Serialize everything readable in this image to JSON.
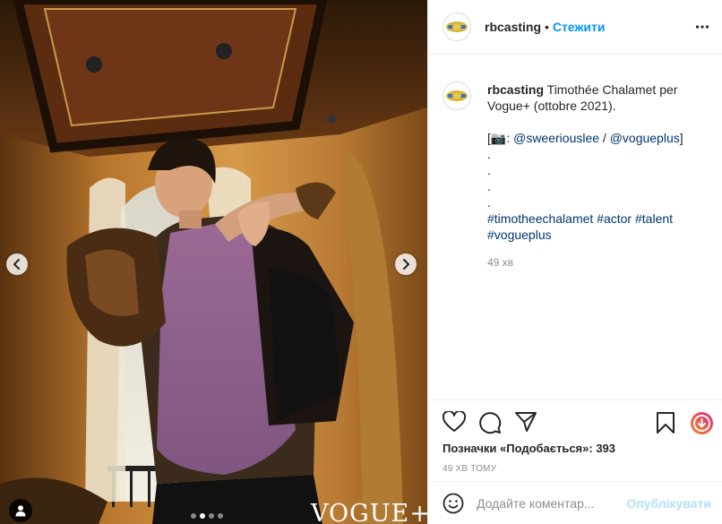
{
  "post": {
    "username": "rbcasting",
    "separator": "•",
    "follow_label": "Стежити",
    "more_icon": "more-dots-icon"
  },
  "caption": {
    "username": "rbcasting",
    "text_line1": "Timothée Chalamet per",
    "text_line2": "Vogue+ (ottobre 2021).",
    "credit_prefix": "[",
    "camera_emoji": "📷",
    "credit_colon": ": ",
    "mention1": "@sweeriouslee",
    "credit_sep": " / ",
    "mention2": "@vogueplus",
    "credit_suffix": "]",
    "dots": [
      ".",
      ".",
      ".",
      "."
    ],
    "hashtags_line1": [
      "#timotheechalamet",
      "#actor",
      "#talent"
    ],
    "hashtags_line2": [
      "#vogueplus"
    ],
    "time_ago": "49 хв"
  },
  "photo": {
    "watermark": "VOGUE+",
    "carousel_total": 4,
    "carousel_active": 2
  },
  "actions": {
    "likes_label": "Позначки «Подобається»: ",
    "likes_count": "393",
    "posted": "49 хв тому"
  },
  "comment": {
    "placeholder": "Додайте коментар...",
    "publish_label": "Опублікувати"
  },
  "colors": {
    "follow": "#0095f6",
    "link": "#00376b",
    "publish_disabled": "#b2dffc",
    "reels_gradient": [
      "#f58529",
      "#dd2a7b"
    ]
  }
}
